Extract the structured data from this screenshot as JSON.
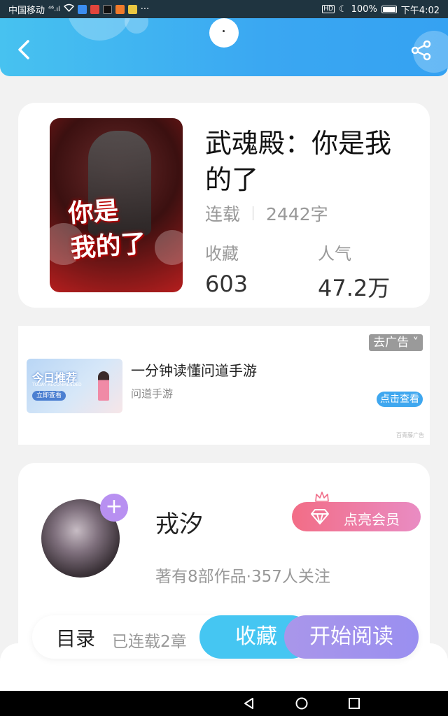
{
  "status_bar": {
    "carrier": "中国移动",
    "signal_text": "⁴⁶.ıl",
    "more": "···",
    "battery": "100%",
    "time": "下午4:02",
    "icons": [
      "wifi-icon",
      "app-icon-blue",
      "app-icon-red",
      "app-icon-black",
      "app-icon-orange",
      "app-icon-yellow",
      "hd-icon",
      "moon-icon",
      "battery-icon"
    ]
  },
  "header": {
    "back_icon": "chevron-left-icon",
    "share_icon": "share-icon"
  },
  "book": {
    "cover_text": "你是\n我的了",
    "title": "武魂殿：你是我的了",
    "status": "连载",
    "word_count": "2442字",
    "stats": [
      {
        "label": "收藏",
        "value": "603"
      },
      {
        "label": "人气",
        "value": "47.2万"
      }
    ]
  },
  "ad": {
    "close_label": "去广告 ˅",
    "thumb_title": "今日推荐",
    "thumb_subtitle": "TODAY RECOMMENDED",
    "thumb_button": "立即查看",
    "title": "一分钟读懂问道手游",
    "subtitle": "问道手游",
    "cta": "点击查看",
    "source": "百青藤广告"
  },
  "author": {
    "name": "戎汐",
    "follow_label": "+",
    "vip_label": "点亮会员",
    "meta": "著有8部作品·357人关注"
  },
  "action_bar": {
    "toc_label": "目录",
    "chapter_count": "已连载2章",
    "collect_label": "收藏",
    "read_label": "开始阅读"
  },
  "colors": {
    "header_blue": "#3aa7f2",
    "collect_blue": "#45c6f2",
    "read_purple": "#9a8ff0",
    "vip_pink": "#f26d86"
  }
}
